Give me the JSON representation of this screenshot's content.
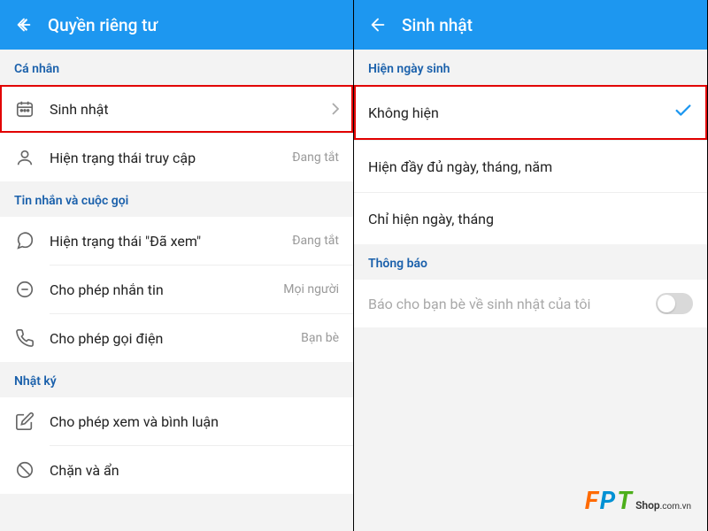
{
  "left": {
    "headerTitle": "Quyền riêng tư",
    "sections": {
      "personal": {
        "title": "Cá nhân",
        "birthday": {
          "label": "Sinh nhật"
        },
        "onlineStatus": {
          "label": "Hiện trạng thái truy cập",
          "trailing": "Đang tắt"
        }
      },
      "messagesCalls": {
        "title": "Tin nhắn và cuộc gọi",
        "seenStatus": {
          "label": "Hiện trạng thái \"Đã xem\"",
          "trailing": "Đang tắt"
        },
        "allowMessage": {
          "label": "Cho phép nhắn tin",
          "trailing": "Mọi người"
        },
        "allowCall": {
          "label": "Cho phép gọi điện",
          "trailing": "Bạn bè"
        }
      },
      "diary": {
        "title": "Nhật ký",
        "viewComment": {
          "label": "Cho phép xem và bình luận"
        },
        "blockHide": {
          "label": "Chặn và ẩn"
        }
      }
    }
  },
  "right": {
    "headerTitle": "Sinh nhật",
    "showBirthdaySection": "Hiện ngày sinh",
    "options": {
      "none": {
        "label": "Không hiện",
        "selected": true
      },
      "full": {
        "label": "Hiện đầy đủ ngày, tháng, năm",
        "selected": false
      },
      "dayMonth": {
        "label": "Chỉ hiện ngày, tháng",
        "selected": false
      }
    },
    "notificationSection": "Thông báo",
    "notifyFriends": {
      "label": "Báo cho bạn bè về sinh nhật của tôi"
    }
  },
  "watermark": {
    "f": "F",
    "p": "P",
    "t": "T",
    "shop": "Shop",
    "dom": ".com.vn"
  }
}
